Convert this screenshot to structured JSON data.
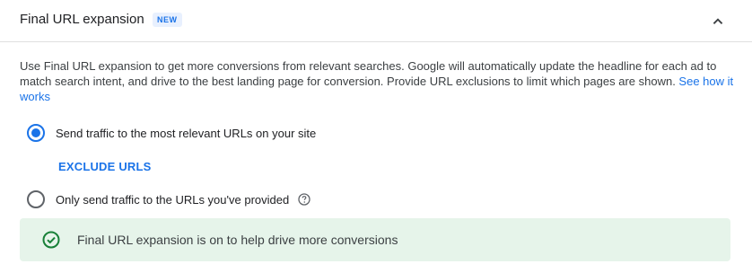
{
  "section": {
    "title": "Final URL expansion",
    "badge": "NEW",
    "collapse_icon": "chevron-up-icon"
  },
  "description": {
    "text": "Use Final URL expansion to get more conversions from relevant searches. Google will automatically update the headline for each ad to match search intent, and drive to the best landing page for conversion. Provide URL exclusions to limit which pages are shown. ",
    "link": "See how it works"
  },
  "options": [
    {
      "label": "Send traffic to the most relevant URLs on your site",
      "selected": true
    },
    {
      "label": "Only send traffic to the URLs you've provided",
      "selected": false,
      "help_icon": "help-circle-icon"
    }
  ],
  "exclude_urls_label": "EXCLUDE URLS",
  "notice": {
    "icon": "check-circle-icon",
    "text": "Final URL expansion is on to help drive more conversions"
  },
  "colors": {
    "accent": "#1a73e8",
    "success": "#188038",
    "notice_bg": "#e6f4ea"
  }
}
